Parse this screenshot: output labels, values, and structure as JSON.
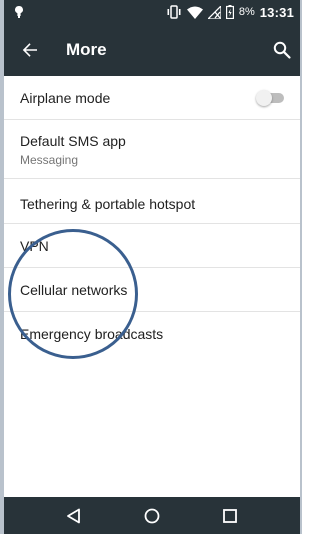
{
  "status_bar": {
    "battery_percent": "8%",
    "time": "13:31",
    "icons": [
      "notification-icon",
      "vibrate-icon",
      "wifi-icon",
      "no-signal-icon",
      "battery-charging-icon"
    ]
  },
  "app_bar": {
    "title": "More",
    "back_icon": "arrow-back-icon",
    "search_icon": "search-icon",
    "background": "#283339"
  },
  "settings": {
    "items": [
      {
        "label": "Airplane mode",
        "toggle": false
      },
      {
        "label": "Default SMS app",
        "summary": "Messaging"
      },
      {
        "label": "Tethering & portable hotspot"
      },
      {
        "label": "VPN"
      },
      {
        "label": "Cellular networks"
      },
      {
        "label": "Emergency broadcasts"
      }
    ]
  },
  "annotation": {
    "color": "#3a5f8f",
    "highlighted_item": "Cellular networks"
  },
  "nav_bar": {
    "buttons": [
      "back-triangle-icon",
      "home-circle-icon",
      "recents-square-icon"
    ]
  }
}
